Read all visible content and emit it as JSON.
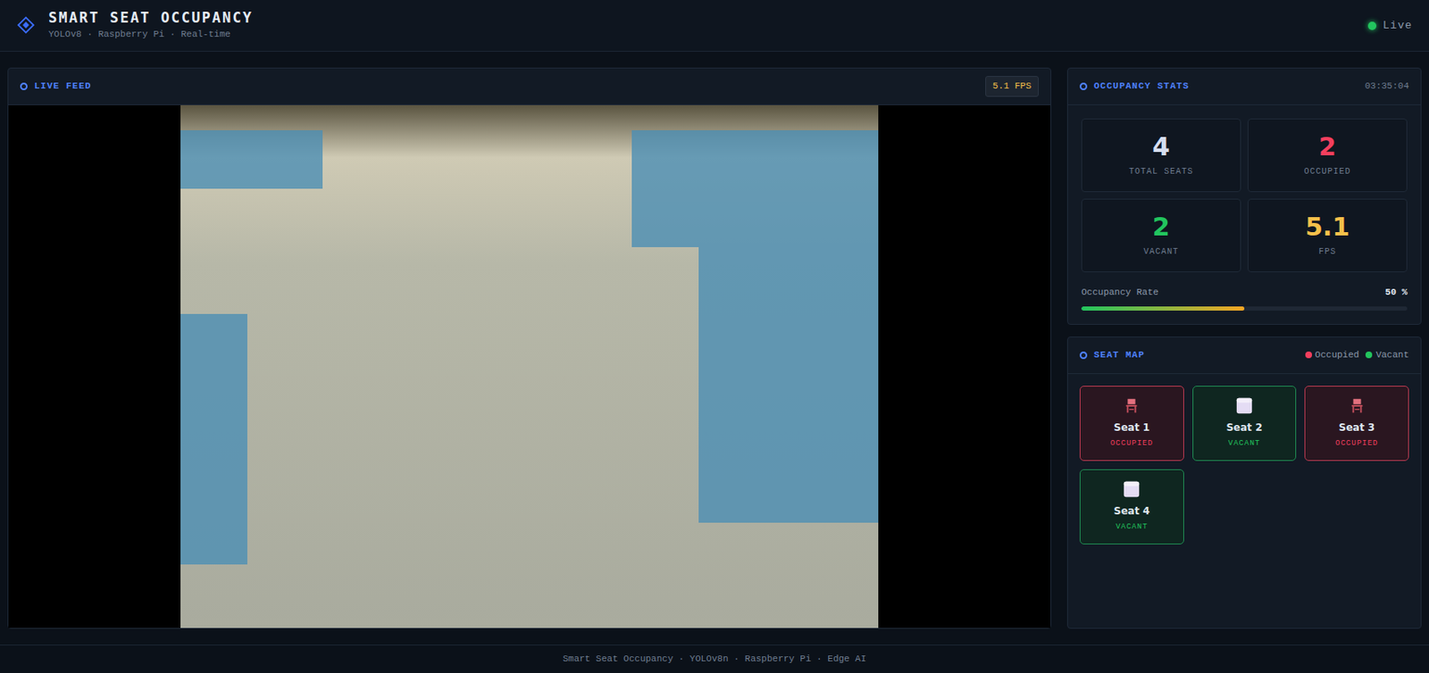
{
  "header": {
    "title": "SMART SEAT OCCUPANCY",
    "subtitle": "YOLOv8 · Raspberry Pi · Real-time",
    "status": {
      "label": "Live",
      "on": true,
      "color": "#22c55e"
    }
  },
  "feed": {
    "title": "LIVE FEED",
    "fps_badge": "5.1 FPS"
  },
  "stats": {
    "title": "OCCUPANCY STATS",
    "time": "03:35:04",
    "tiles": [
      {
        "value": "4",
        "label": "TOTAL SEATS",
        "color": "#d6def0"
      },
      {
        "value": "2",
        "label": "OCCUPIED",
        "color": "#f43f5e"
      },
      {
        "value": "2",
        "label": "VACANT",
        "color": "#22c55e"
      },
      {
        "value": "5.1",
        "label": "FPS",
        "color": "#f5c04a"
      }
    ],
    "rate": {
      "label": "Occupancy Rate",
      "reading": "50 %",
      "level": 0.5
    }
  },
  "seat_map": {
    "title": "SEAT MAP",
    "legend": [
      {
        "label": "Occupied",
        "color": "#f43f5e"
      },
      {
        "label": "Vacant",
        "color": "#22c55e"
      }
    ],
    "seats": [
      {
        "name": "Seat 1",
        "status": "OCCUPIED",
        "kind": "occupied"
      },
      {
        "name": "Seat 2",
        "status": "VACANT",
        "kind": "vacant"
      },
      {
        "name": "Seat 3",
        "status": "OCCUPIED",
        "kind": "occupied"
      },
      {
        "name": "Seat 4",
        "status": "VACANT",
        "kind": "vacant"
      }
    ]
  },
  "footer": "Smart Seat Occupancy · YOLOv8n · Raspberry Pi · Edge AI"
}
